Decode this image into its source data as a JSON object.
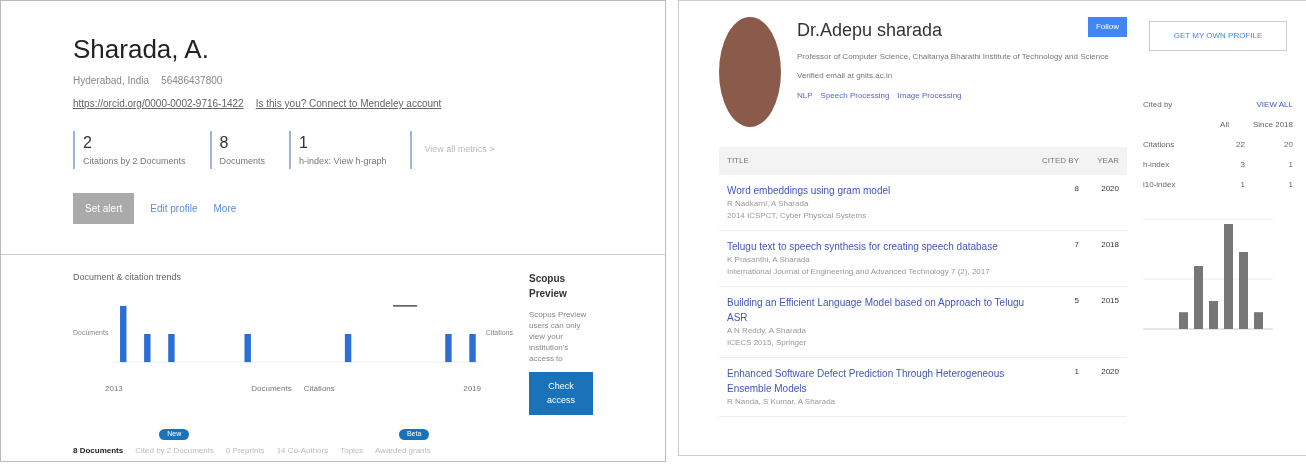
{
  "scopus": {
    "name": "Sharada, A.",
    "affiliation": "Hyderabad, India",
    "author_id": "56486437800",
    "orcid": "https://orcid.org/0000-0002-9716-1422",
    "connect": "Is this you? Connect to Mendeley account",
    "metrics": [
      {
        "value": "2",
        "label": "Citations by 2 Documents"
      },
      {
        "value": "8",
        "label": "Documents"
      },
      {
        "value": "1",
        "label": "h-index: View h-graph"
      }
    ],
    "metrics_link": "View all metrics >",
    "actions": [
      {
        "kind": "primary",
        "label": "Set alert"
      },
      {
        "kind": "link",
        "label": "Edit profile"
      },
      {
        "kind": "link",
        "label": "More"
      }
    ],
    "trends_title": "Document & citation trends",
    "y_left": "Documents",
    "y_right": "Citations",
    "x_start": "2013",
    "x_end": "2019",
    "legend": [
      "Documents",
      "Citations"
    ],
    "preview_title": "Scopus Preview",
    "preview_text": "Scopus Preview users can only view your institution's access to",
    "preview_button": "Check access",
    "tabs": [
      {
        "label": "8 Documents",
        "selected": true
      },
      {
        "label": "Cited by 2 Documents",
        "selected": false,
        "badge": "New"
      },
      {
        "label": "0 Preprints",
        "selected": false
      },
      {
        "label": "14 Co-Authors",
        "selected": false
      },
      {
        "label": "Topics",
        "selected": false
      },
      {
        "label": "Awarded grants",
        "selected": false,
        "badge": "Beta"
      }
    ]
  },
  "scholar": {
    "name": "Dr.Adepu sharada",
    "follow": "Follow",
    "own_profile": "GET MY OWN PROFILE",
    "affiliation": "Professor of Computer Science, Chaitanya Bharathi Institute of Technology and Science",
    "email": "Verified email at gnits.ac.in",
    "interests": [
      "NLP",
      "Speech Processing",
      "Image Processing"
    ],
    "columns": [
      "TITLE",
      "CITED BY",
      "YEAR"
    ],
    "articles": [
      {
        "title": "Word embeddings using gram model",
        "authors": "R Nadkarni, A Sharada",
        "venue": "2014 ICSPCT, Cyber Physical Systems",
        "cited": "8",
        "year": "2020"
      },
      {
        "title": "Telugu text to speech synthesis for creating speech database",
        "authors": "K Prasanthi, A Sharada",
        "venue": "International Journal of Engineering and Advanced Technology 7 (2), 2017",
        "cited": "7",
        "year": "2018"
      },
      {
        "title": "Building an Efficient Language Model based on Approach to Telugu ASR",
        "authors": "A N Reddy, A Sharada",
        "venue": "ICECS 2015, Springer",
        "cited": "5",
        "year": "2015"
      },
      {
        "title": "Enhanced Software Defect Prediction Through Heterogeneous Ensemble Models",
        "authors": "R Nanda, S Kumar, A Sharada",
        "cited": "1",
        "year": "2020"
      }
    ],
    "cited_title": "Cited by",
    "view_all": "VIEW ALL",
    "stat_heads": [
      "All",
      "Since 2018"
    ],
    "stats": [
      {
        "label": "Citations",
        "all": "22",
        "since": "20"
      },
      {
        "label": "h-index",
        "all": "3",
        "since": "1"
      },
      {
        "label": "i10-index",
        "all": "1",
        "since": "1"
      }
    ]
  }
}
